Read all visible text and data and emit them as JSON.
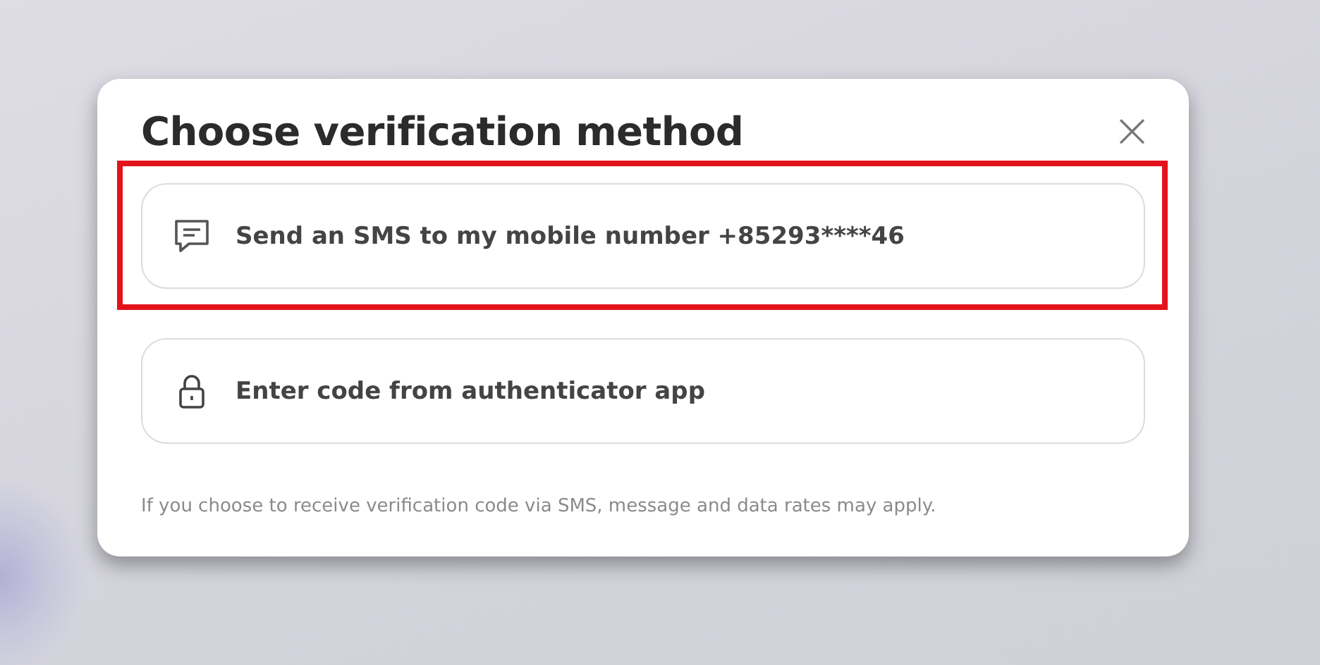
{
  "dialog": {
    "title": "Choose verification method",
    "close_label": "×"
  },
  "options": [
    {
      "kind": "sms",
      "label": "Send an SMS to my mobile number +85293****46",
      "highlighted": true
    },
    {
      "kind": "authenticator",
      "label": "Enter code from authenticator app",
      "highlighted": false
    }
  ],
  "footnote": "If you choose to receive verification code via SMS, message and data rates may apply."
}
